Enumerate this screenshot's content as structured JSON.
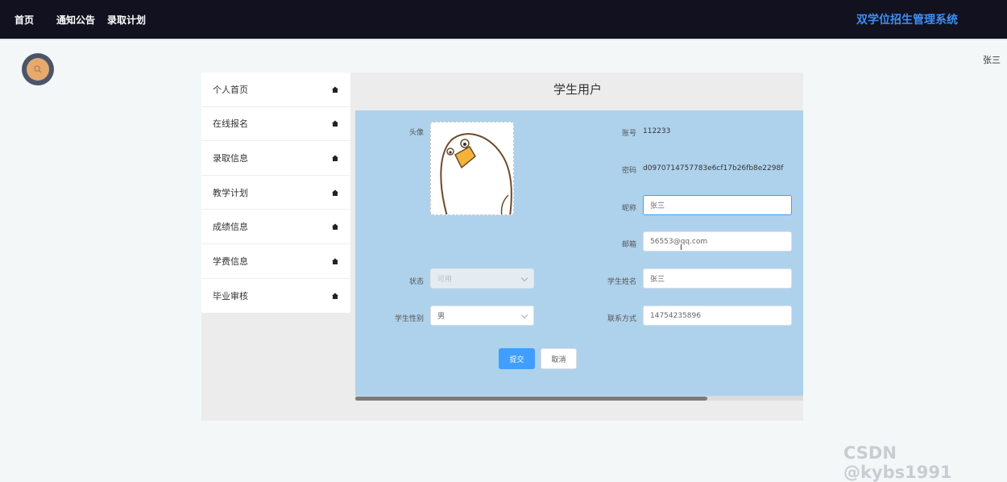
{
  "nav": {
    "home": "首页",
    "notice": "通知公告",
    "plan": "录取计划",
    "brand": "双学位招生管理系统"
  },
  "user": {
    "name": "张三"
  },
  "sidebar": {
    "items": [
      {
        "label": "个人首页"
      },
      {
        "label": "在线报名"
      },
      {
        "label": "录取信息"
      },
      {
        "label": "教学计划"
      },
      {
        "label": "成绩信息"
      },
      {
        "label": "学费信息"
      },
      {
        "label": "毕业审核"
      }
    ]
  },
  "page": {
    "title": "学生用户"
  },
  "form": {
    "avatar_label": "头像",
    "account_label": "账号",
    "account_value": "112233",
    "password_label": "密码",
    "password_value": "d0970714757783e6cf17b26fb8e2298f",
    "nickname_label": "昵称",
    "nickname_value": "张三",
    "email_label": "邮箱",
    "email_value": "56553@qq.com",
    "status_label": "状态",
    "status_value": "可用",
    "student_name_label": "学生姓名",
    "student_name_value": "张三",
    "gender_label": "学生性别",
    "gender_value": "男",
    "phone_label": "联系方式",
    "phone_value": "14754235896",
    "submit_label": "提交",
    "cancel_label": "取消"
  },
  "colors": {
    "topbar": "#121120",
    "brand": "#3d8ff2",
    "form_bg": "#aed2ec",
    "primary": "#409eff"
  },
  "watermark": "CSDN @kybs1991"
}
